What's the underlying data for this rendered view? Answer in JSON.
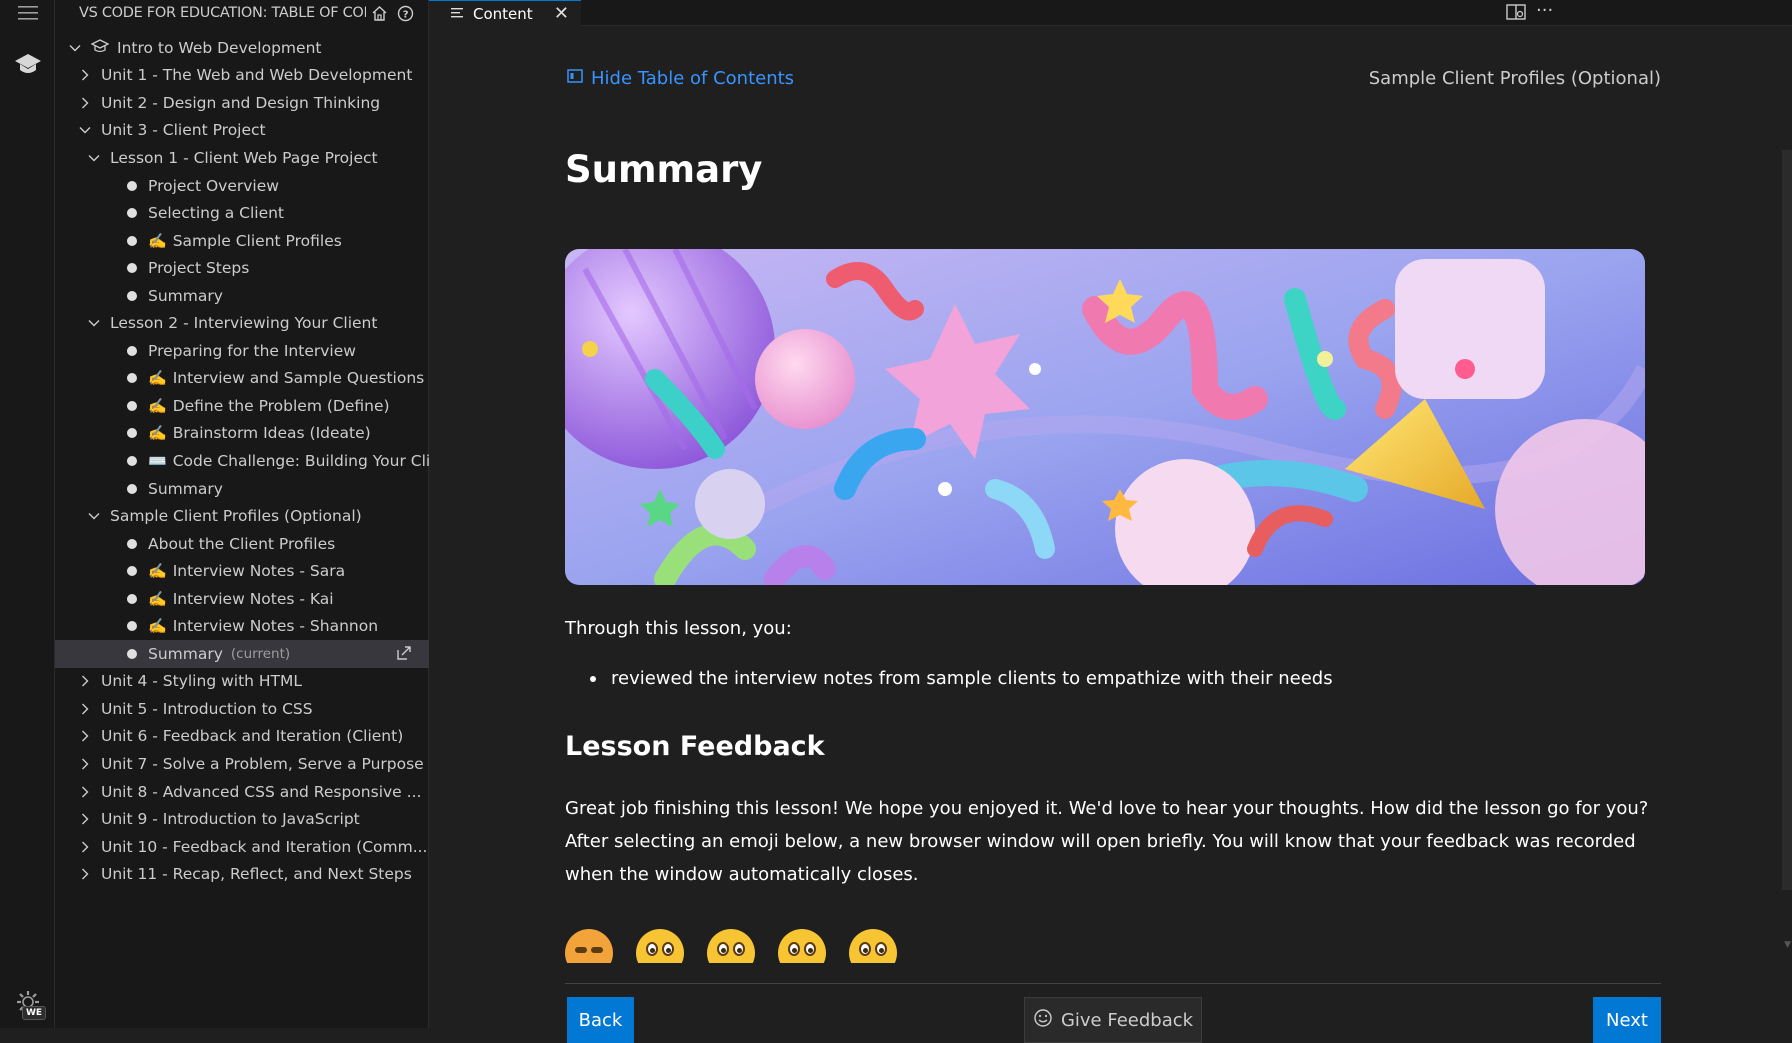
{
  "activity_bar": {
    "badge": "WE"
  },
  "sidebar": {
    "title": "VS CODE FOR EDUCATION: TABLE OF CON...",
    "tree": [
      {
        "level": 0,
        "type": "folder-open",
        "label": "Intro to Web Development",
        "icon": "graduation-cap"
      },
      {
        "level": 1,
        "type": "folder-closed",
        "label": "Unit 1 - The Web and Web Development"
      },
      {
        "level": 1,
        "type": "folder-closed",
        "label": "Unit 2 - Design and Design Thinking"
      },
      {
        "level": 1,
        "type": "folder-open",
        "label": "Unit 3 - Client Project"
      },
      {
        "level": 2,
        "type": "folder-open",
        "label": "Lesson 1 - Client Web Page Project"
      },
      {
        "level": 3,
        "type": "item",
        "label": "Project Overview"
      },
      {
        "level": 3,
        "type": "item",
        "label": "Selecting a Client"
      },
      {
        "level": 3,
        "type": "item",
        "emoji": "✍️",
        "label": "Sample Client Profiles"
      },
      {
        "level": 3,
        "type": "item",
        "label": "Project Steps"
      },
      {
        "level": 3,
        "type": "item",
        "label": "Summary"
      },
      {
        "level": 2,
        "type": "folder-open",
        "label": "Lesson 2 - Interviewing Your Client"
      },
      {
        "level": 3,
        "type": "item",
        "label": "Preparing for the Interview"
      },
      {
        "level": 3,
        "type": "item",
        "emoji": "✍️",
        "label": "Interview and Sample Questions (E..."
      },
      {
        "level": 3,
        "type": "item",
        "emoji": "✍️",
        "label": "Define the Problem (Define)"
      },
      {
        "level": 3,
        "type": "item",
        "emoji": "✍️",
        "label": "Brainstorm Ideas (Ideate)"
      },
      {
        "level": 3,
        "type": "item",
        "emoji": "⌨️",
        "label": "Code Challenge: Building Your Clie..."
      },
      {
        "level": 3,
        "type": "item",
        "label": "Summary"
      },
      {
        "level": 2,
        "type": "folder-open",
        "label": "Sample Client Profiles (Optional)"
      },
      {
        "level": 3,
        "type": "item",
        "label": "About the Client Profiles"
      },
      {
        "level": 3,
        "type": "item",
        "emoji": "✍️",
        "label": "Interview Notes - Sara"
      },
      {
        "level": 3,
        "type": "item",
        "emoji": "✍️",
        "label": "Interview Notes - Kai"
      },
      {
        "level": 3,
        "type": "item",
        "emoji": "✍️",
        "label": "Interview Notes - Shannon"
      },
      {
        "level": 3,
        "type": "item",
        "label": "Summary",
        "current": "(current)",
        "selected": true
      },
      {
        "level": 1,
        "type": "folder-closed",
        "label": "Unit 4 - Styling with HTML"
      },
      {
        "level": 1,
        "type": "folder-closed",
        "label": "Unit 5 - Introduction to CSS"
      },
      {
        "level": 1,
        "type": "folder-closed",
        "label": "Unit 6 - Feedback and Iteration (Client)"
      },
      {
        "level": 1,
        "type": "folder-closed",
        "label": "Unit 7 - Solve a Problem, Serve a Purpose"
      },
      {
        "level": 1,
        "type": "folder-closed",
        "label": "Unit 8 - Advanced CSS and Responsive ..."
      },
      {
        "level": 1,
        "type": "folder-closed",
        "label": "Unit 9 - Introduction to JavaScript"
      },
      {
        "level": 1,
        "type": "folder-closed",
        "label": "Unit 10 - Feedback and Iteration (Comm..."
      },
      {
        "level": 1,
        "type": "folder-closed",
        "label": "Unit 11 - Recap, Reflect, and Next Steps"
      }
    ]
  },
  "tabs": [
    {
      "label": "Content",
      "active": true
    }
  ],
  "content": {
    "hide_toc_label": "Hide Table of Contents",
    "breadcrumb_right": "Sample Client Profiles (Optional)",
    "title": "Summary",
    "intro": "Through this lesson, you:",
    "bullets": [
      "reviewed the interview notes from sample clients to empathize with their needs"
    ],
    "feedback_heading": "Lesson Feedback",
    "feedback_text": "Great job finishing this lesson! We hope you enjoyed it. We'd love to hear your thoughts. How did the lesson go for you? After selecting an emoji below, a new browser window will open briefly. You will know that your feedback was recorded when the window automatically closes.",
    "emojis": [
      "angry-face",
      "neutral-face",
      "slightly-happy-face",
      "happy-face",
      "very-happy-face"
    ],
    "back_label": "Back",
    "give_feedback_label": "Give Feedback",
    "next_label": "Next"
  },
  "colors": {
    "accent": "#0078d4",
    "link": "#3794ff",
    "background": "#1f1f1f",
    "sidebar": "#181818"
  }
}
